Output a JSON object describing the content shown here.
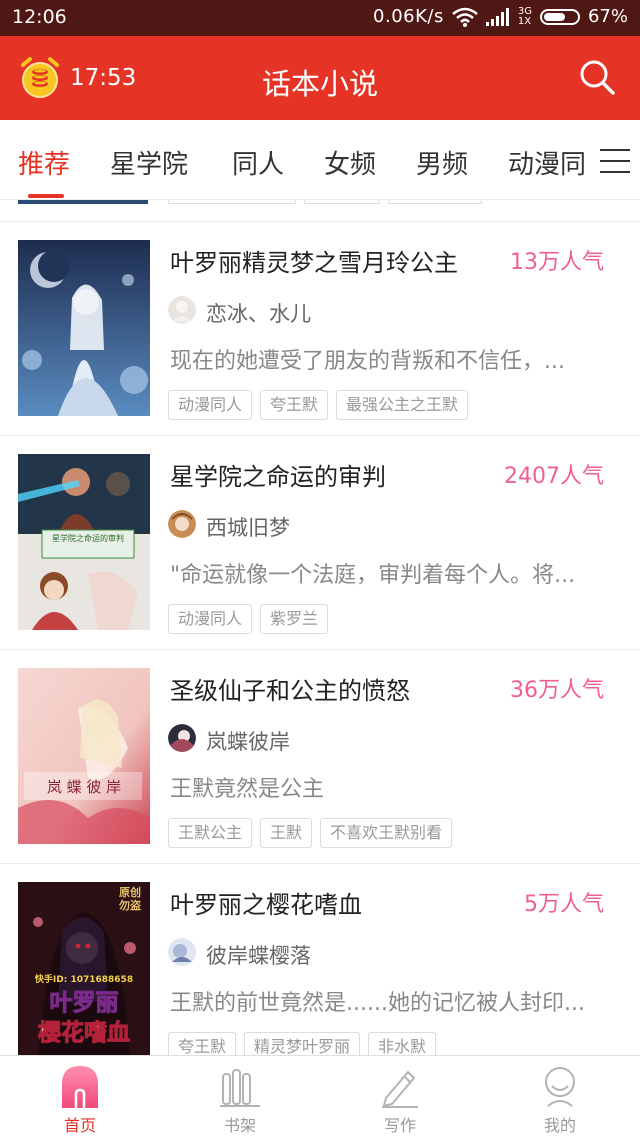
{
  "status_bar": {
    "time": "12:06",
    "network_speed": "0.06K/s",
    "signal_type": "3G",
    "signal_slot": "1X",
    "battery_percent": "67%",
    "battery_level": 0.67
  },
  "header": {
    "timer": "17:53",
    "title": "话本小说",
    "icons": [
      "alarm-clock-coins-icon",
      "search-icon"
    ]
  },
  "tabs": {
    "items": [
      {
        "label": "推荐",
        "active": true
      },
      {
        "label": "星学院",
        "active": false
      },
      {
        "label": "同人",
        "active": false
      },
      {
        "label": "女频",
        "active": false
      },
      {
        "label": "男频",
        "active": false
      },
      {
        "label": "动漫同",
        "active": false
      }
    ],
    "menu_icon": "hamburger-menu-icon"
  },
  "books": [
    {
      "title": "叶罗丽精灵梦之雪月玲公主",
      "popularity": "13万人气",
      "author": "恋冰、水儿",
      "description": "现在的她遭受了朋友的背叛和不信任，...",
      "tags": [
        "动漫同人",
        "夸王默",
        "最强公主之王默"
      ]
    },
    {
      "title": "星学院之命运的审判",
      "popularity": "2407人气",
      "author": "西城旧梦",
      "description": "\"命运就像一个法庭，审判着每个人。将...",
      "tags": [
        "动漫同人",
        "紫罗兰"
      ],
      "cover_text": "星学院之命运的审判"
    },
    {
      "title": "圣级仙子和公主的愤怒",
      "popularity": "36万人气",
      "author": "岚蝶彼岸",
      "description": "王默竟然是公主",
      "tags": [
        "王默公主",
        "王默",
        "不喜欢王默别看"
      ],
      "cover_text": "岚 蝶 彼 岸"
    },
    {
      "title": "叶罗丽之樱花嗜血",
      "popularity": "5万人气",
      "author": "彼岸蝶樱落",
      "description": "王默的前世竟然是......她的记忆被人封印...",
      "tags": [
        "夸王默",
        "精灵梦叶罗丽",
        "非水默"
      ],
      "cover_text_top": "原创\n勿盗",
      "cover_text_id": "快手ID: 1071688658",
      "cover_text_title1": "叶罗丽",
      "cover_text_title2": "樱花嗜血"
    }
  ],
  "bottom_nav": [
    {
      "label": "首页",
      "icon": "home-icon",
      "active": true
    },
    {
      "label": "书架",
      "icon": "bookshelf-icon",
      "active": false
    },
    {
      "label": "写作",
      "icon": "pencil-icon",
      "active": false
    },
    {
      "label": "我的",
      "icon": "profile-icon",
      "active": false
    }
  ],
  "colors": {
    "header_red": "#e53326",
    "status_bar": "#4f1814",
    "popularity_pink": "#f0608e",
    "active_nav": "#e53326"
  }
}
